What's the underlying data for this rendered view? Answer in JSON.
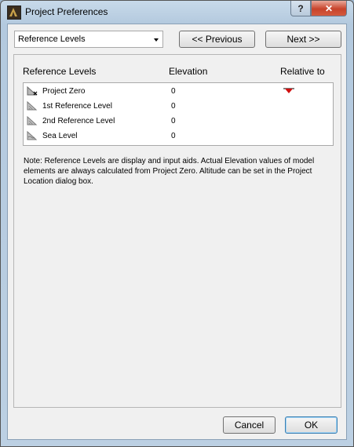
{
  "window": {
    "title": "Project Preferences",
    "help_label": "?",
    "close_label": "✕"
  },
  "toolbar": {
    "category_select": "Reference Levels",
    "previous_label": "<< Previous",
    "next_label": "Next >>"
  },
  "table": {
    "headers": {
      "name": "Reference Levels",
      "elevation": "Elevation",
      "relative": "Relative to"
    },
    "rows": [
      {
        "name": "Project Zero",
        "elevation": "0",
        "relative_marker": true
      },
      {
        "name": "1st Reference Level",
        "elevation": "0",
        "relative_marker": false
      },
      {
        "name": "2nd Reference Level",
        "elevation": "0",
        "relative_marker": false
      },
      {
        "name": "Sea Level",
        "elevation": "0",
        "relative_marker": false
      }
    ]
  },
  "note": "Note: Reference Levels are display and input aids. Actual Elevation values of model elements are always calculated from Project Zero. Altitude can be set in the Project Location dialog box.",
  "footer": {
    "cancel_label": "Cancel",
    "ok_label": "OK"
  },
  "colors": {
    "marker": "#d10f0f",
    "close_button": "#c7432b"
  }
}
